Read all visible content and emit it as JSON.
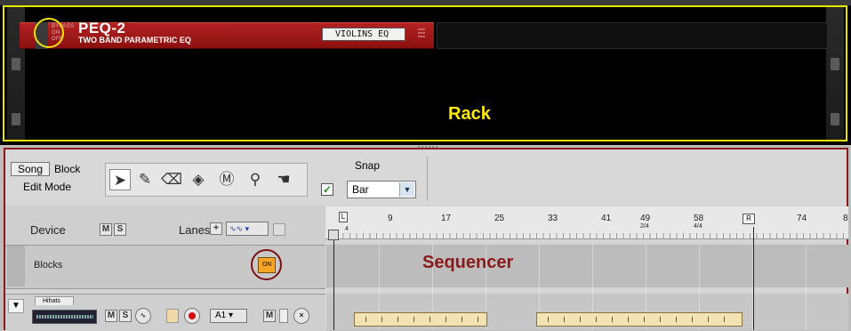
{
  "rack": {
    "label": "Rack",
    "device": {
      "bypass_lines": [
        "BYPASS",
        "ON",
        "OFF"
      ],
      "name": "PEQ-2",
      "subtitle": "TWO BAND PARAMETRIC EQ",
      "patch_name": "VIOLINS EQ"
    }
  },
  "toolbar": {
    "song_label": "Song",
    "block_label": "Block",
    "edit_mode_label": "Edit Mode",
    "tools": [
      "selection-arrow",
      "pencil",
      "eraser",
      "razor",
      "mute",
      "magnify",
      "hand"
    ],
    "snap": {
      "title": "Snap",
      "checked": true,
      "value": "Bar"
    }
  },
  "track_header": {
    "device_label": "Device",
    "mute_label": "M",
    "solo_label": "S",
    "lanes_label": "Lanes",
    "lanes_add": "+"
  },
  "blocks_row": {
    "label": "Blocks",
    "on_label": "ON"
  },
  "hihat_row": {
    "tab_label": "Hihats",
    "select_value": "A1",
    "mute_label": "M",
    "solo_label": "S",
    "lane_mute_label": "M"
  },
  "sequencer": {
    "label": "Sequencer",
    "loop_left": "L",
    "loop_right": "R",
    "ruler_ticks": [
      "9",
      "17",
      "25",
      "33",
      "41",
      "49",
      "58",
      "74",
      "8"
    ],
    "signatures": {
      "start": "4",
      "bar49": "2/4",
      "bar58": "4/4"
    }
  },
  "colors": {
    "rack_highlight": "#e6e600",
    "sequencer_highlight": "#8b1a1a",
    "device_red": "#a01818",
    "on_button": "#f6a623",
    "block_fill": "#f3e3b0"
  }
}
